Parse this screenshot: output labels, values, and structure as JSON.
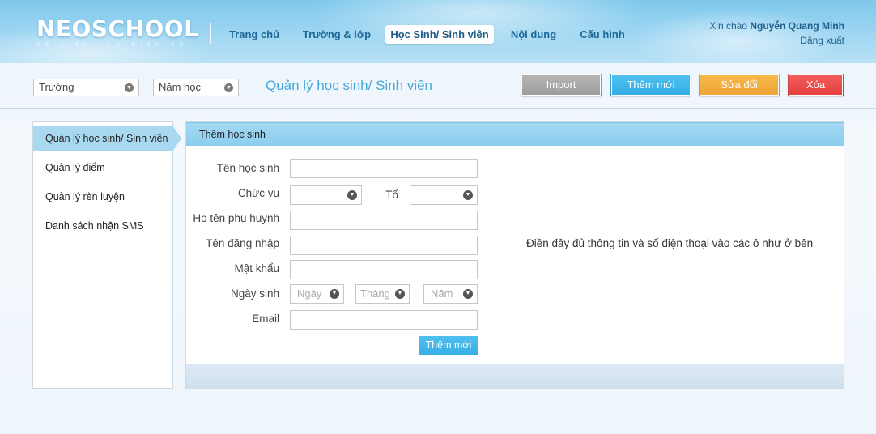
{
  "brand": {
    "name": "NEOSCHOOL",
    "tagline": "SỔ LIÊN LẠC ĐIỆN TỬ"
  },
  "nav": {
    "items": [
      {
        "label": "Trang chủ",
        "active": false
      },
      {
        "label": "Trường & lớp",
        "active": false
      },
      {
        "label": "Học Sinh/ Sinh viên",
        "active": true
      },
      {
        "label": "Nội dung",
        "active": false
      },
      {
        "label": "Cấu hình",
        "active": false
      }
    ]
  },
  "user": {
    "greeting": "Xin chào",
    "name": "Nguyễn Quang Minh",
    "logout": "Đăng xuất"
  },
  "toolbar": {
    "school_select": "Trường",
    "year_select": "Năm học",
    "page_title": "Quản lý học sinh/ Sinh viên",
    "buttons": {
      "import": "Import",
      "add": "Thêm mới",
      "edit": "Sửa đổi",
      "delete": "Xóa"
    },
    "button_colors": {
      "import": "#a9a9a9",
      "add": "#3eb5ea",
      "edit": "#f0a93b",
      "delete": "#ea4848"
    }
  },
  "sidebar": {
    "items": [
      {
        "label": "Quản lý học sinh/ Sinh viên",
        "active": true
      },
      {
        "label": "Quản lý điểm",
        "active": false
      },
      {
        "label": "Quản lý rèn luyện",
        "active": false
      },
      {
        "label": "Danh sách nhận SMS",
        "active": false
      }
    ]
  },
  "form": {
    "title": "Thêm học sinh",
    "student_name_label": "Tên học sinh",
    "role_label": "Chức vụ",
    "group_label": "Tổ",
    "parent_name_label": "Họ tên phụ huynh",
    "username_label": "Tên đăng nhập",
    "password_label": "Mật khẩu",
    "dob_label": "Ngày sinh",
    "dob_day": "Ngày",
    "dob_month": "Tháng",
    "dob_year": "Năm",
    "email_label": "Email",
    "submit": "Thêm mới",
    "hint": "Điền đầy đủ thông tin và số điện thoại vào các ô như ở bên"
  },
  "icons": {
    "dropdown": "chevron-down-icon"
  }
}
